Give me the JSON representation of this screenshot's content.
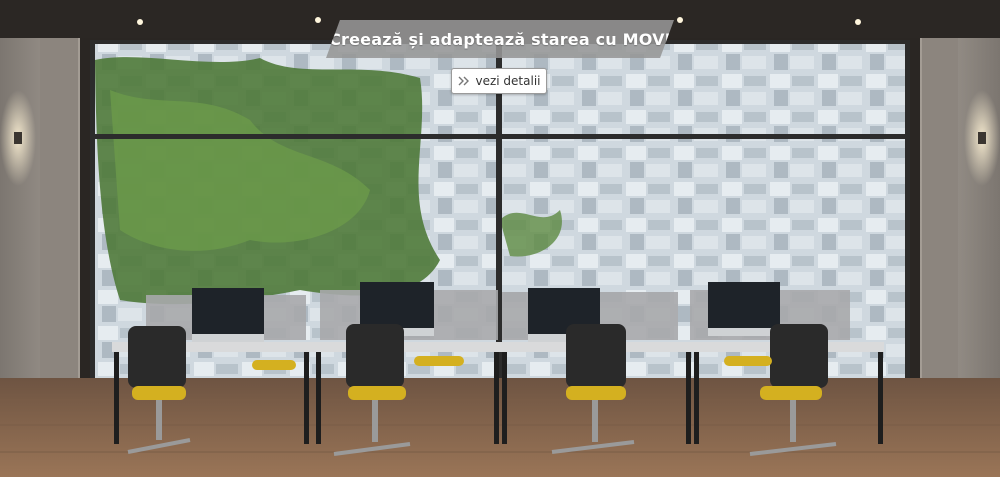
{
  "banner": {
    "headline": "Creează și adaptează starea cu MOVI"
  },
  "cta": {
    "label": "vezi detalii",
    "icon": "double-chevron-right-icon"
  },
  "colors": {
    "banner_bg": "#969696",
    "cta_bg": "#ffffff",
    "chair_seat": "#d4b020",
    "floor": "#8a6a4e"
  }
}
